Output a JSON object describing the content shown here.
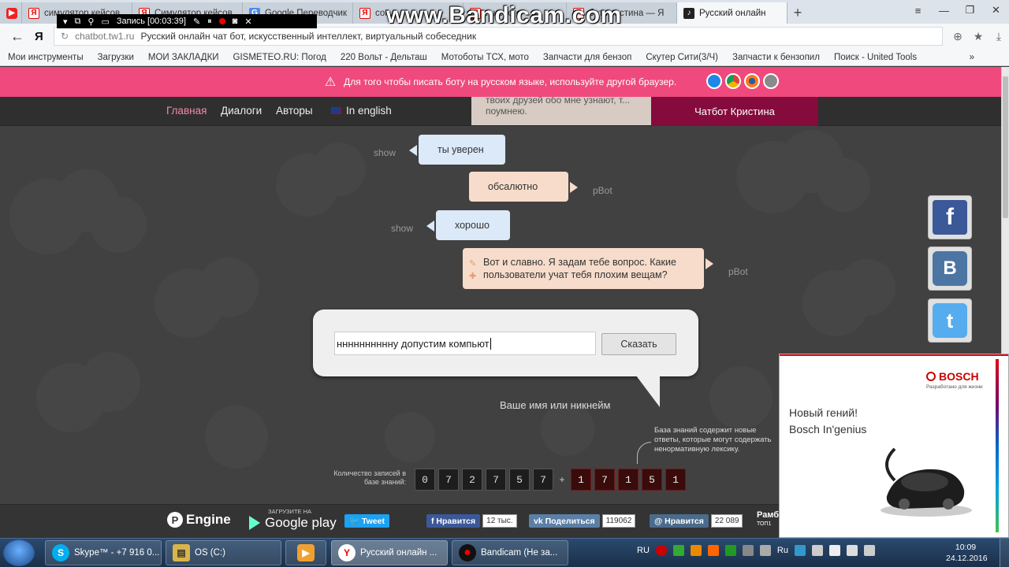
{
  "browser": {
    "tabs": [
      {
        "label": "",
        "icon": "youtube"
      },
      {
        "label": "симулятор кейсов",
        "icon": "yandex"
      },
      {
        "label": "Симулятор кейсов",
        "icon": "yandex"
      },
      {
        "label": "Google Переводчик",
        "icon": "google"
      },
      {
        "label": "сон...",
        "icon": "yandex"
      },
      {
        "label": "...нового",
        "icon": "yandex"
      },
      {
        "label": "бот кристина — Я",
        "icon": "yandex"
      },
      {
        "label": "Русский онлайн",
        "icon": "dark"
      }
    ],
    "new_tab": "+",
    "address": {
      "host": "chatbot.tw1.ru",
      "title": "Русский онлайн чат бот, искусственный интеллект, виртуальный собеседник"
    },
    "bookmarks": [
      "Мои инструменты",
      "Загрузки",
      "МОИ ЗАКЛАДКИ",
      "GISMETEO.RU: Погод",
      "220 Вольт - Дельташ",
      "Мотоботы ТСХ, мото",
      "Запчасти для бензоп",
      "Скутер Сити(3/Ч)",
      "Запчасти к бензопил",
      "Поиск - United Tools"
    ],
    "bookmarks_more": "»"
  },
  "recorder": {
    "label": "Запись [00:03:39]"
  },
  "watermark": "www.Bandicam.com",
  "site": {
    "warning": "Для того чтобы писать боту на русском языке, используйте другой браузер.",
    "nav": [
      "Главная",
      "Диалоги",
      "Авторы",
      "In english"
    ],
    "info_text": "твоих друзей обо мне узнают, т... поумнею.",
    "brand_button": "Чатбот Кристина",
    "messages": [
      {
        "from": "show",
        "text": "ты уверен",
        "kind": "user"
      },
      {
        "from": "pBot",
        "text": "обсалютно",
        "kind": "bot"
      },
      {
        "from": "show",
        "text": "хорошо",
        "kind": "user"
      },
      {
        "from": "pBot",
        "text": "Вот и славно. Я задам тебе вопрос. Какие пользователи учат тебя плохим вещам?",
        "kind": "bot"
      }
    ],
    "input_value": "нннннннннну допустим компьют",
    "say_button": "Сказать",
    "nickname_hint": "Ваше имя или никнейм",
    "kb_note": "База знаний содержит новые ответы, которые могут содержать ненормативную лексику.",
    "count_label": "Количество записей в базе знаний:",
    "count_digits": [
      "0",
      "7",
      "2",
      "7",
      "5",
      "7"
    ],
    "count_plus": "+",
    "count_new_digits": [
      "1",
      "7",
      "1",
      "5",
      "1"
    ],
    "footer": {
      "engine": "Engine",
      "gplay_small": "ЗАГРУЗИТЕ НА",
      "gplay_big": "Google play",
      "tweet": "Tweet",
      "fb_like": "Нравится",
      "fb_count": "12 тыс.",
      "vk_share": "Поделиться",
      "vk_count": "119062",
      "ok_like": "Нравится",
      "ok_count": "22 089",
      "rambler": "Рамб",
      "rambler_sub": "ТОП1"
    }
  },
  "ad": {
    "brand": "BOSCH",
    "tagline": "Разработано для жизни",
    "line1": "Новый гений!",
    "line2": "Bosch In'genius"
  },
  "taskbar": {
    "items": [
      {
        "label": "Skype™ - +7 916 0...",
        "icon": "S"
      },
      {
        "label": "OS (C:)",
        "icon": "▤"
      },
      {
        "label": "",
        "icon": "▶"
      },
      {
        "label": "Русский онлайн ...",
        "icon": "Y"
      },
      {
        "label": "Bandicam (Не за...",
        "icon": "●"
      }
    ],
    "lang": "RU",
    "lang2": "Ru",
    "time": "10:09",
    "date": "24.12.2016"
  }
}
